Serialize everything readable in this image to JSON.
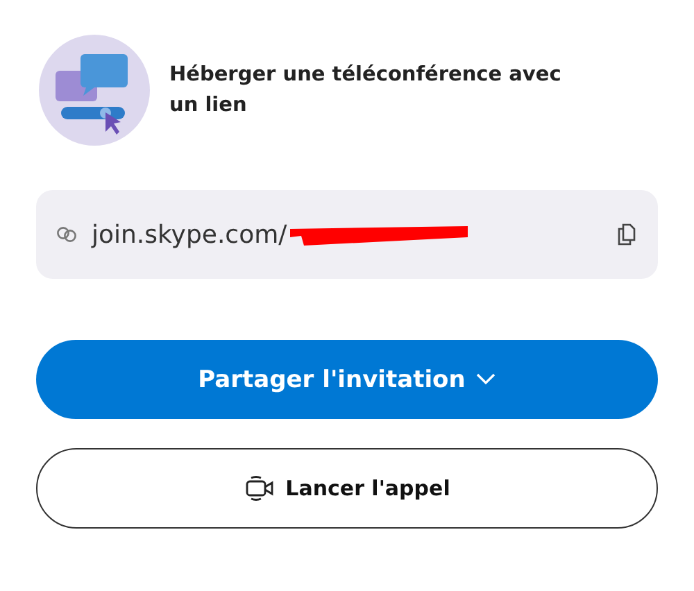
{
  "header": {
    "title": "Héberger une téléconférence avec un lien"
  },
  "link_field": {
    "value": "join.skype.com/",
    "redacted": true
  },
  "buttons": [
    {
      "kind": "primary",
      "label": "Partager l'invitation"
    },
    {
      "kind": "outline",
      "label": "Lancer l'appel"
    }
  ]
}
